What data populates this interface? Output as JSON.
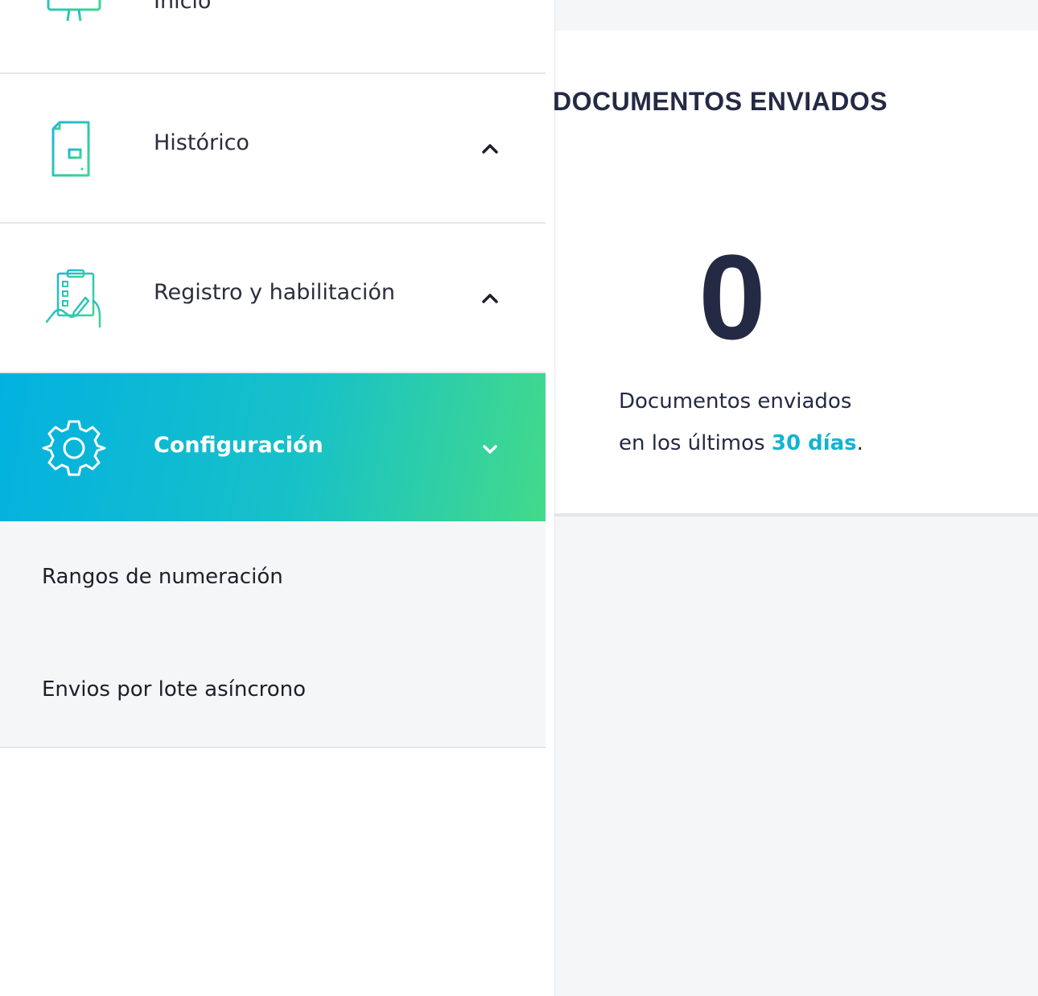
{
  "sidebar": {
    "items": [
      {
        "label": "Inicio",
        "icon": "monitor-icon"
      },
      {
        "label": "Histórico",
        "icon": "document-list-icon",
        "chevron": "chevron-up-icon"
      },
      {
        "label": "Registro y habilitación",
        "icon": "clipboard-hand-icon",
        "chevron": "chevron-up-icon"
      },
      {
        "label": "Configuración",
        "icon": "gear-icon",
        "chevron": "chevron-down-icon",
        "active": true
      }
    ],
    "submenu": [
      {
        "label": "Rangos de numeración"
      },
      {
        "label": "Envios por lote asíncrono"
      }
    ]
  },
  "card": {
    "title": "DOCUMENTOS ENVIADOS",
    "count": "0",
    "line1": "Documentos enviados",
    "line2_prefix": "en los últimos ",
    "line2_highlight": "30 días",
    "line2_suffix": "."
  },
  "colors": {
    "dark_text": "#252a44",
    "accent": "#12b3d4",
    "active_gradient_start": "#03b1e0",
    "active_gradient_end": "#43da8a",
    "icon_teal": "#1fc0b8"
  }
}
